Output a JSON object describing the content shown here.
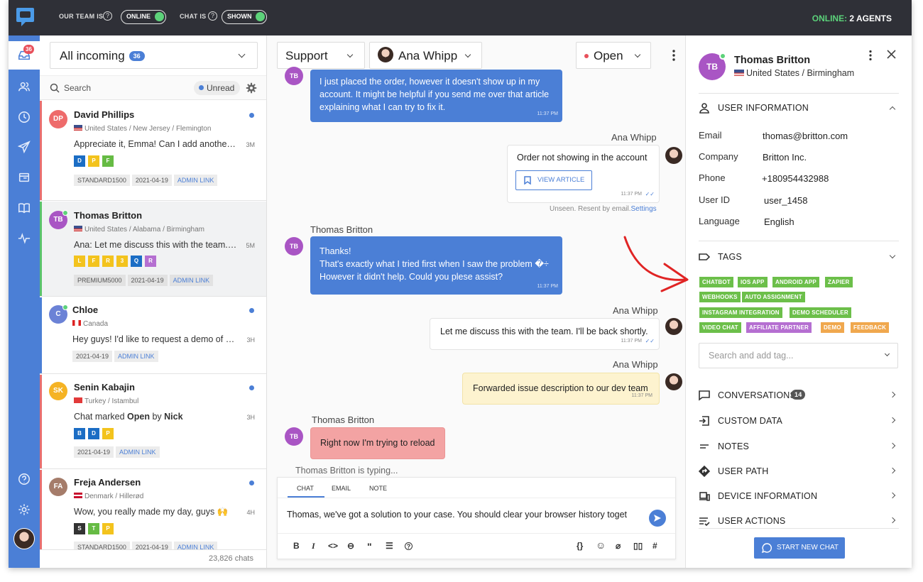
{
  "topbar": {
    "team_label": "OUR TEAM IS",
    "team_status": "ONLINE",
    "chat_label": "CHAT IS",
    "chat_status": "SHOWN",
    "online_label": "ONLINE:",
    "online_value": "2 AGENTS"
  },
  "nav": {
    "inbox_badge": "36"
  },
  "list": {
    "inbox_title": "All incoming",
    "inbox_count": "36",
    "search_placeholder": "Search",
    "unread_filter": "Unread",
    "total": "23,826 chats",
    "conversations": [
      {
        "name": "David Phillips",
        "initials": "DP",
        "location": "United States / New Jersey / Flemington",
        "message": "Appreciate it, Emma! Can I add another one?",
        "time": "3M",
        "tags": [
          "D",
          "P",
          "F"
        ],
        "meta": [
          "STANDARD1500",
          "2021-04-19",
          "ADMIN LINK"
        ]
      },
      {
        "name": "Thomas Britton",
        "initials": "TB",
        "location": "United States / Alabama / Birmingham",
        "message": "Ana: Let me discuss this with the team. I'll be back shortly.",
        "time": "5M",
        "tags": [
          "L",
          "F",
          "R",
          "3",
          "Q",
          "R"
        ],
        "meta": [
          "PREMIUM5000",
          "2021-04-19",
          "ADMIN LINK"
        ]
      },
      {
        "name": "Chloe",
        "initials": "C",
        "location": "Canada",
        "message": "Hey guys! I'd like to request a demo of your product",
        "time": "3H",
        "tags": [],
        "meta": [
          "2021-04-19",
          "ADMIN LINK"
        ]
      },
      {
        "name": "Senin Kabajin",
        "initials": "SK",
        "location": "Turkey / Istambul",
        "message_pre": "Chat marked ",
        "message_b1": "Open",
        "message_mid": " by ",
        "message_b2": "Nick",
        "time": "3H",
        "tags": [
          "B",
          "D",
          "P"
        ],
        "meta": [
          "2021-04-19",
          "ADMIN LINK"
        ]
      },
      {
        "name": "Freja Andersen",
        "initials": "FA",
        "location": "Denmark / Hillerød",
        "message": "Wow, you really made my day, guys 🙌",
        "time": "4H",
        "tags": [
          "S",
          "T",
          "P"
        ],
        "meta": [
          "STANDARD1500",
          "2021-04-19",
          "ADMIN LINK"
        ]
      }
    ]
  },
  "chat": {
    "department": "Support",
    "agent": "Ana Whipp",
    "status": "Open",
    "messages": [
      {
        "text": "I just placed the order, however it doesn't show up in my account. It might be helpful if you send me over that article explaining what I can try to fix it.",
        "time": "11:37 PM"
      },
      {
        "sender": "Ana Whipp",
        "text": "Order not showing in the account",
        "button": "VIEW ARTICLE",
        "time": "11:37 PM",
        "note": "Unseen. Resent by email.",
        "note_link": "Settings"
      },
      {
        "sender": "Thomas Britton",
        "lines": [
          "Thanks!",
          "That's exactly what I tried first when I saw the problem �÷",
          "However it didn't help. Could you plese assist?"
        ],
        "time": "11:37 PM"
      },
      {
        "sender": "Ana Whipp",
        "text": "Let me discuss this with the team. I'll be back shortly.",
        "time": "11:37 PM"
      },
      {
        "sender": "Ana Whipp",
        "text": "Forwarded issue description to our dev team",
        "time": "11:37 PM"
      },
      {
        "sender": "Thomas Britton",
        "text": "Right now I'm trying to reload"
      }
    ],
    "typing": "Thomas Britton is typing...",
    "composer_tabs": [
      "CHAT",
      "EMAIL",
      "NOTE"
    ],
    "composer_text": "Thomas, we've got a solution to your case. You should clear your browser history toget"
  },
  "profile": {
    "initials": "TB",
    "name": "Thomas Britton",
    "location": "United States / Birmingham",
    "user_info_title": "USER INFORMATION",
    "fields": [
      {
        "key": "Email",
        "value": "thomas@britton.com"
      },
      {
        "key": "Company",
        "value": "Britton Inc."
      },
      {
        "key": "Phone",
        "value": "+180954432988"
      },
      {
        "key": "User ID",
        "value": "user_1458"
      },
      {
        "key": "Language",
        "value": "English"
      }
    ],
    "tags_title": "TAGS",
    "tags": [
      {
        "label": "CHATBOT",
        "color": "#6cbf4a"
      },
      {
        "label": "IOS APP",
        "color": "#6cbf4a"
      },
      {
        "label": "ANDROID APP",
        "color": "#6cbf4a"
      },
      {
        "label": "ZAPIER",
        "color": "#6cbf4a"
      },
      {
        "label": "WEBHOOKS",
        "color": "#6cbf4a"
      },
      {
        "label": "AUTO ASSIGNMENT",
        "color": "#6cbf4a"
      },
      {
        "label": "INSTAGRAM INTEGRATION",
        "color": "#6cbf4a"
      },
      {
        "label": "DEMO SCHEDULER",
        "color": "#6cbf4a"
      },
      {
        "label": "VIDEO CHAT",
        "color": "#6cbf4a"
      },
      {
        "label": "AFFILIATE PARTNER",
        "color": "#b56fd1"
      },
      {
        "label": "DEMO",
        "color": "#f0a84e"
      },
      {
        "label": "FEEDBACK",
        "color": "#f0a84e"
      }
    ],
    "tag_search_placeholder": "Search and add tag...",
    "sections": [
      {
        "label": "CONVERSATIONS",
        "badge": "14"
      },
      {
        "label": "CUSTOM DATA"
      },
      {
        "label": "NOTES"
      },
      {
        "label": "USER PATH"
      },
      {
        "label": "DEVICE INFORMATION"
      },
      {
        "label": "USER ACTIONS"
      }
    ],
    "start_chat": "START NEW CHAT"
  }
}
